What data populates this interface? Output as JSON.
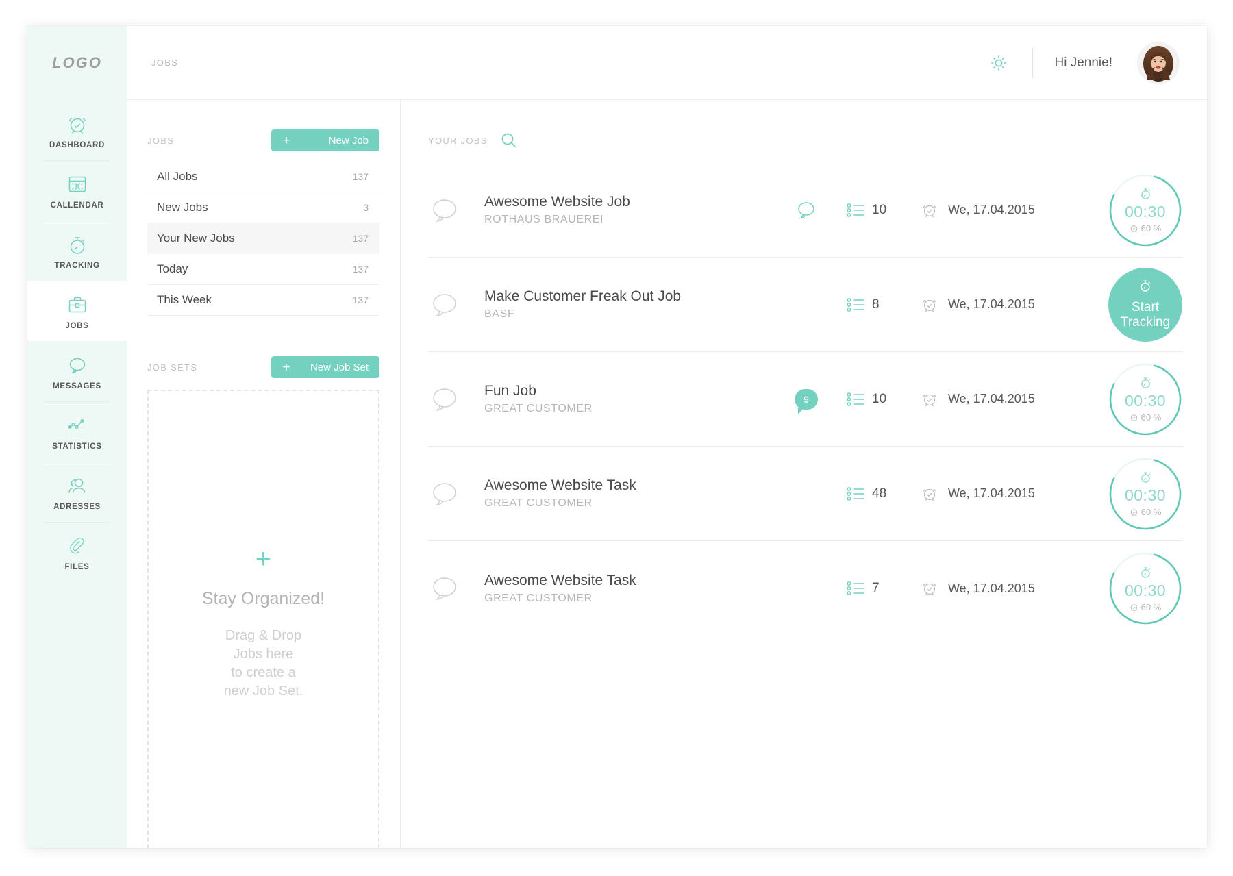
{
  "brand": {
    "logo_text": "LOGO",
    "accent": "#74d1c0",
    "sidebar_bg": "#eef8f5"
  },
  "sidebar": {
    "items": [
      {
        "label": "DASHBOARD",
        "icon": "alarm-clock-check-icon",
        "active": false
      },
      {
        "label": "CALLENDAR",
        "icon": "calendar-icon",
        "active": false
      },
      {
        "label": "TRACKING",
        "icon": "stopwatch-icon",
        "active": false
      },
      {
        "label": "JOBS",
        "icon": "briefcase-icon",
        "active": true
      },
      {
        "label": "MESSAGES",
        "icon": "speech-bubble-icon",
        "active": false
      },
      {
        "label": "STATISTICS",
        "icon": "line-chart-icon",
        "active": false
      },
      {
        "label": "ADRESSES",
        "icon": "contacts-icon",
        "active": false
      },
      {
        "label": "FILES",
        "icon": "paperclip-icon",
        "active": false
      }
    ]
  },
  "topbar": {
    "breadcrumb": "JOBS",
    "settings_icon": "gear-icon",
    "greeting": "Hi Jennie!",
    "avatar_name": "avatar"
  },
  "left_panel": {
    "jobs_section_title": "JOBS",
    "new_job_button": {
      "plus": "+",
      "label": "New Job"
    },
    "filters": [
      {
        "label": "All Jobs",
        "count": "137",
        "active": false
      },
      {
        "label": "New Jobs",
        "count": "3",
        "active": false
      },
      {
        "label": "Your New Jobs",
        "count": "137",
        "active": true
      },
      {
        "label": "Today",
        "count": "137",
        "active": false
      },
      {
        "label": "This Week",
        "count": "137",
        "active": false
      }
    ],
    "jobsets_section_title": "JOB SETS",
    "new_jobset_button": {
      "plus": "+",
      "label": "New Job Set"
    },
    "dropzone": {
      "plus": "+",
      "title": "Stay Organized!",
      "line1": "Drag & Drop",
      "line2": "Jobs here",
      "line3": "to create a",
      "line4": "new Job Set."
    }
  },
  "right_panel": {
    "title": "YOUR JOBS",
    "search_icon": "search-icon",
    "jobs": [
      {
        "title": "Awesome Website Job",
        "customer": "ROTHAUS BRAUEREI",
        "comment_badge": "",
        "has_comment_icon": true,
        "tasks": "10",
        "date": "We, 17.04.2015",
        "tracker": {
          "type": "timer",
          "time": "00:30",
          "percent": "60 %",
          "progress": 0.78
        }
      },
      {
        "title": "Make Customer Freak Out Job",
        "customer": "BASF",
        "comment_badge": "",
        "has_comment_icon": false,
        "tasks": "8",
        "date": "We, 17.04.2015",
        "tracker": {
          "type": "start",
          "label_line1": "Start",
          "label_line2": "Tracking"
        }
      },
      {
        "title": "Fun Job",
        "customer": "GREAT CUSTOMER",
        "comment_badge": "9",
        "has_comment_icon": false,
        "tasks": "10",
        "date": "We, 17.04.2015",
        "tracker": {
          "type": "timer",
          "time": "00:30",
          "percent": "60 %",
          "progress": 0.78
        }
      },
      {
        "title": "Awesome Website Task",
        "customer": "GREAT CUSTOMER",
        "comment_badge": "",
        "has_comment_icon": false,
        "tasks": "48",
        "date": "We, 17.04.2015",
        "tracker": {
          "type": "timer",
          "time": "00:30",
          "percent": "60 %",
          "progress": 0.78
        }
      },
      {
        "title": "Awesome Website Task",
        "customer": "GREAT CUSTOMER",
        "comment_badge": "",
        "has_comment_icon": false,
        "tasks": "7",
        "date": "We, 17.04.2015",
        "tracker": {
          "type": "timer",
          "time": "00:30",
          "percent": "60 %",
          "progress": 0.78
        }
      }
    ]
  }
}
